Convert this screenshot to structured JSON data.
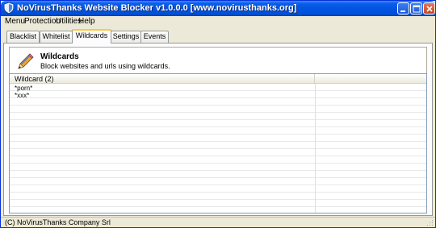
{
  "window": {
    "title": "NoVirusThanks Website Blocker v1.0.0.0 [www.novirusthanks.org]"
  },
  "menu": {
    "items": [
      "Menu",
      "Protection",
      "Utilities",
      "Help"
    ]
  },
  "tabs": [
    {
      "label": "Blacklist",
      "active": false
    },
    {
      "label": "Whitelist",
      "active": false
    },
    {
      "label": "Wildcards",
      "active": true
    },
    {
      "label": "Settings",
      "active": false
    },
    {
      "label": "Events",
      "active": false
    }
  ],
  "header": {
    "icon": "pencil-icon",
    "title": "Wildcards",
    "subtitle": "Block websites and urls using wildcards."
  },
  "list": {
    "column_header": "Wildcard (2)",
    "rows": [
      "*porn*",
      "*xxx*"
    ]
  },
  "status": {
    "text": "(C) NoVirusThanks Company Srl"
  },
  "colors": {
    "titlebar": "#0254E3",
    "active_tab_accent": "#FFC83C",
    "window_bg": "#ECE9D8"
  }
}
